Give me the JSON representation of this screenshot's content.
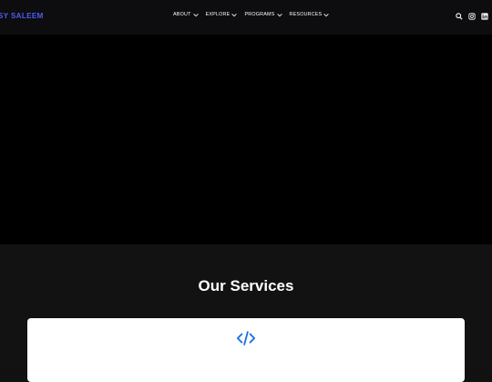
{
  "header": {
    "brand": "SY SALEEM",
    "nav": [
      {
        "label": "ABOUT"
      },
      {
        "label": "EXPLORE"
      },
      {
        "label": "PROGRAMS"
      },
      {
        "label": "RESOURCES"
      }
    ],
    "icons": [
      "search-icon",
      "instagram-icon",
      "linkedin-icon"
    ]
  },
  "services": {
    "title": "Our Services",
    "card_icon": "code-icon",
    "accent": "#1e6fe0"
  },
  "colors": {
    "brand": "#4d5ef5",
    "header_bg": "#0d0d10",
    "hero_bg": "#000000",
    "section_bg": "#121212",
    "card_bg": "#ffffff"
  }
}
